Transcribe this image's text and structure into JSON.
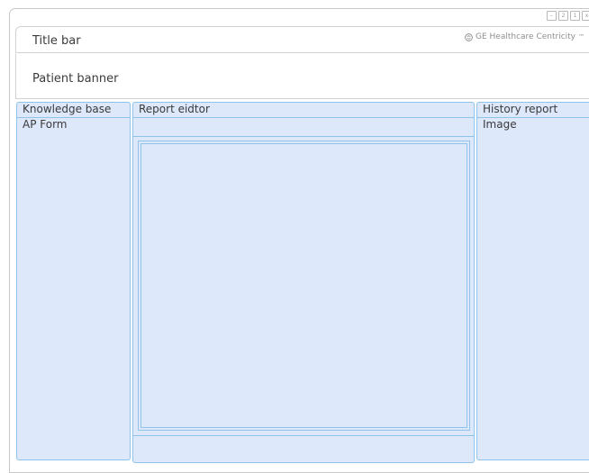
{
  "window": {
    "controls": [
      {
        "name": "minimize",
        "glyph": "–"
      },
      {
        "name": "maximize",
        "glyph": "2"
      },
      {
        "name": "restore",
        "glyph": "1"
      },
      {
        "name": "close",
        "glyph": "x"
      }
    ]
  },
  "title_bar": {
    "label": "Title bar",
    "brand": {
      "logo_icon": "ge-logo-icon",
      "text": "GE Healthcare Centricity",
      "tm": "™"
    }
  },
  "patient_banner": {
    "label": "Patient banner"
  },
  "panels": {
    "knowledge_base": {
      "header": "Knowledge base",
      "subheader": "AP Form"
    },
    "report_editor": {
      "header": "Report eidtor"
    },
    "history_report": {
      "header": "History report",
      "subheader": "Image"
    }
  },
  "colors": {
    "panel_fill": "#dde8fb",
    "panel_border": "#8fc3ea"
  }
}
